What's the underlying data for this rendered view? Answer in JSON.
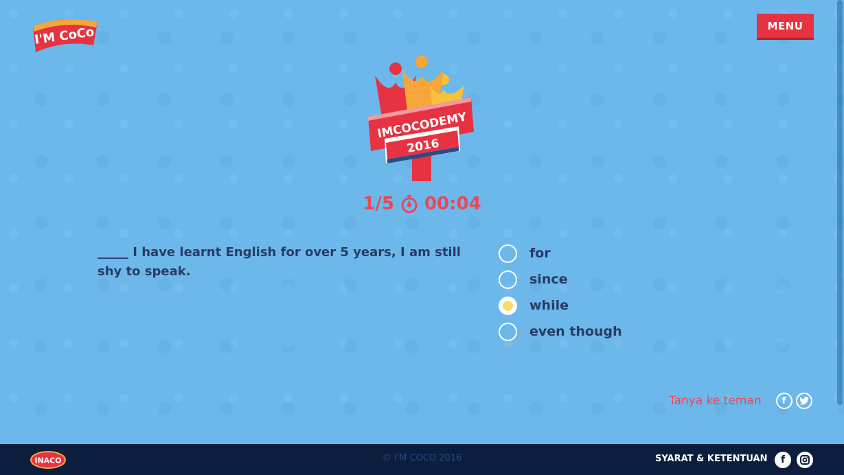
{
  "brand": {
    "logo_text": "I'M COCO"
  },
  "header": {
    "menu_label": "MENU"
  },
  "badge": {
    "title": "IMCOCODEMY",
    "year": "2016"
  },
  "quiz": {
    "progress": "1/5",
    "timer": "00:04",
    "question": "_____ I have learnt English for over 5 years, I am still shy to speak.",
    "options": [
      {
        "label": "for",
        "selected": false
      },
      {
        "label": "since",
        "selected": false
      },
      {
        "label": "while",
        "selected": true
      },
      {
        "label": "even though",
        "selected": false
      }
    ]
  },
  "share": {
    "label": "Tanya ke teman",
    "facebook": "f",
    "twitter": "t"
  },
  "footer": {
    "brand": "INACO",
    "copyright": "© I'M COCO 2016",
    "terms": "SYARAT & KETENTUAN",
    "facebook": "f",
    "instagram": "ig"
  },
  "colors": {
    "background": "#6cb8ea",
    "accent": "#e63241",
    "text": "#2a3a66",
    "footer": "#0c1e3d"
  }
}
